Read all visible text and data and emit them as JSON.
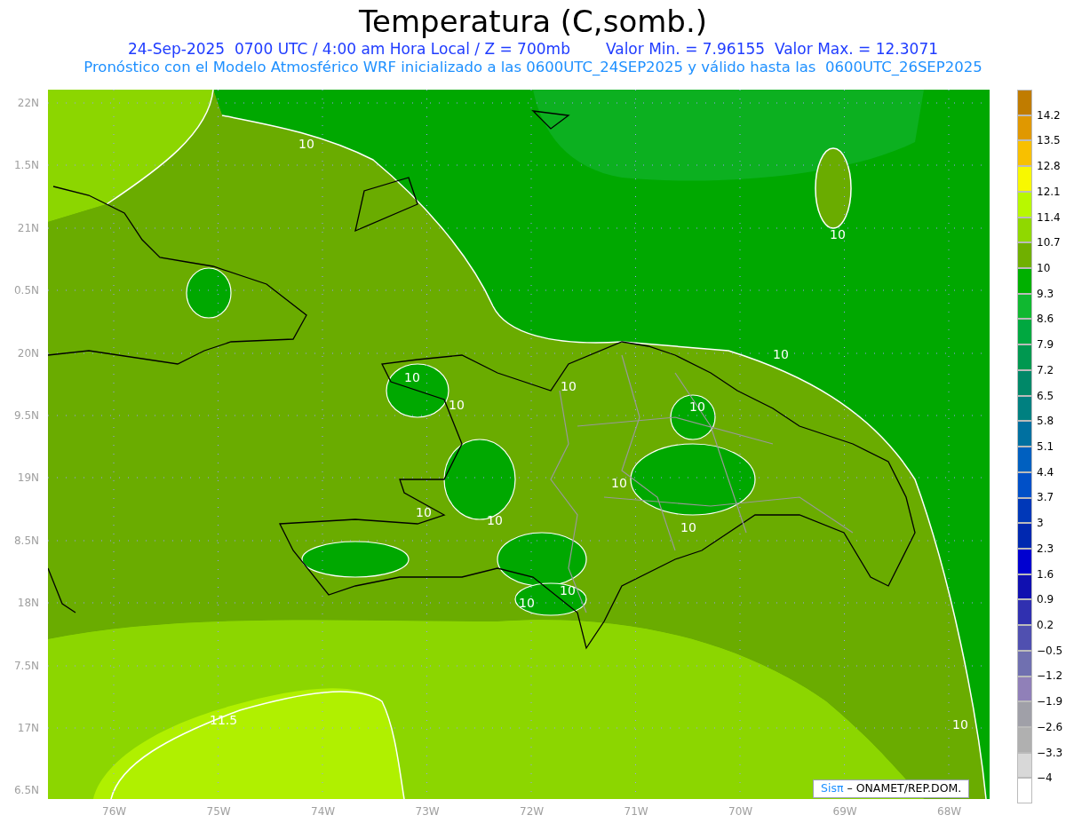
{
  "title": "Temperatura (C,somb.)",
  "info_line": "24-Sep-2025  0700 UTC / 4:00 am Hora Local / Z = 700mb",
  "range_line": "Valor Min. = 7.96155  Valor Max. = 12.3071",
  "model_line": "Pronóstico con el Modelo Atmosférico WRF inicializado a las 0600UTC_24SEP2025 y válido hasta las  0600UTC_26SEP2025",
  "map": {
    "y_labels": [
      "22N",
      "1.5N",
      "21N",
      "0.5N",
      "20N",
      "9.5N",
      "19N",
      "8.5N",
      "18N",
      "7.5N",
      "17N",
      "6.5N"
    ],
    "x_labels": [
      "76W",
      "75W",
      "74W",
      "73W",
      "72W",
      "71W",
      "70W",
      "69W",
      "68W"
    ],
    "contour_labels": [
      "10",
      "10",
      "10",
      "10",
      "10",
      "10",
      "10",
      "10",
      "10",
      "10",
      "10",
      "10",
      "10",
      "10",
      "11.5"
    ],
    "credit": {
      "brand": "Sisπ",
      "text": " – ONAMET/REP.DOM."
    }
  },
  "colorbar": {
    "labels": [
      "14.2",
      "13.5",
      "12.8",
      "12.1",
      "11.4",
      "10.7",
      "10",
      "9.3",
      "8.6",
      "7.9",
      "7.2",
      "6.5",
      "5.8",
      "5.1",
      "4.4",
      "3.7",
      "3",
      "2.3",
      "1.6",
      "0.9",
      "0.2",
      "−0.5",
      "−1.2",
      "−1.9",
      "−2.6",
      "−3.3",
      "−4"
    ],
    "segments": [
      {
        "color": "#c07c00"
      },
      {
        "color": "#e09800"
      },
      {
        "color": "#f8c000"
      },
      {
        "color": "#f8f800"
      },
      {
        "color": "#b8f800"
      },
      {
        "color": "#90d800"
      },
      {
        "color": "#70b000"
      },
      {
        "color": "#00b000"
      },
      {
        "color": "#10b830"
      },
      {
        "color": "#00a840"
      },
      {
        "color": "#009850"
      },
      {
        "color": "#008868"
      },
      {
        "color": "#008080"
      },
      {
        "color": "#0070a0"
      },
      {
        "color": "#0060c0"
      },
      {
        "color": "#0050c8"
      },
      {
        "color": "#0038b8"
      },
      {
        "color": "#0028b0"
      },
      {
        "color": "#0000d0"
      },
      {
        "color": "#1010b0"
      },
      {
        "color": "#3030b0"
      },
      {
        "color": "#5050b0"
      },
      {
        "color": "#7070b0"
      },
      {
        "color": "#9080b8"
      },
      {
        "color": "#a0a0a8"
      },
      {
        "color": "#b0b0b0"
      },
      {
        "color": "#d8d8d8"
      },
      {
        "color": "#ffffff"
      }
    ]
  }
}
